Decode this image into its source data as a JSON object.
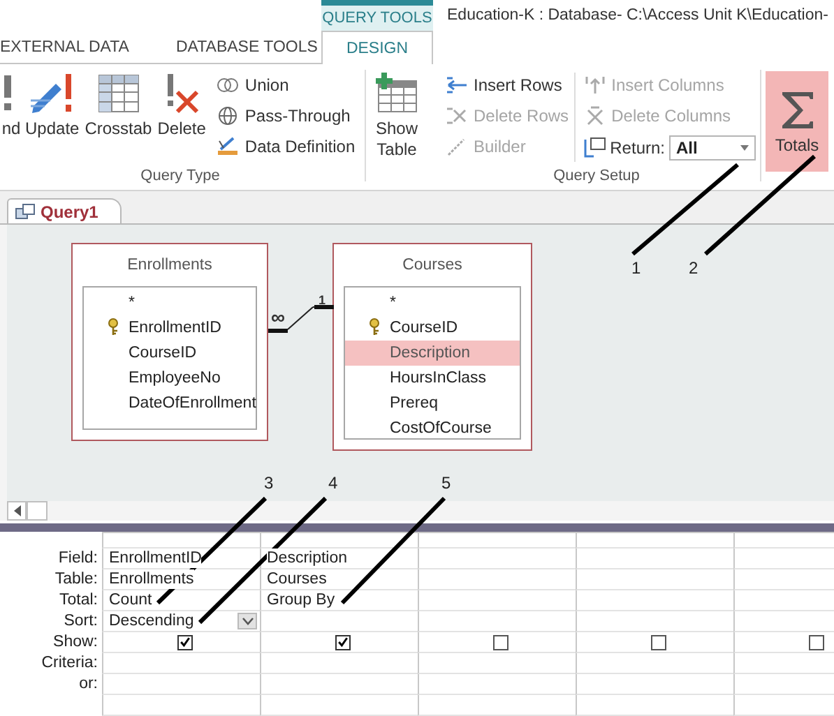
{
  "window": {
    "contextual_tab": "QUERY TOOLS",
    "title": "Education-K : Database- C:\\Access Unit K\\Education-"
  },
  "ribbon_tabs": [
    {
      "label": "EXTERNAL DATA",
      "selected": false
    },
    {
      "label": "DATABASE TOOLS",
      "selected": false
    },
    {
      "label": "DESIGN",
      "selected": true
    }
  ],
  "query_type": {
    "label": "Query Type",
    "large_buttons": [
      {
        "kind": "append",
        "label": "nd"
      },
      {
        "kind": "update",
        "label": "Update"
      },
      {
        "kind": "crosstab",
        "label": "Crosstab"
      },
      {
        "kind": "delete",
        "label": "Delete"
      }
    ],
    "small_buttons": [
      {
        "kind": "union",
        "label": "Union"
      },
      {
        "kind": "passthrough",
        "label": "Pass-Through"
      },
      {
        "kind": "datadef",
        "label": "Data Definition"
      }
    ]
  },
  "show_table": {
    "label": "Show Table"
  },
  "query_setup": {
    "label": "Query Setup",
    "buttons": [
      {
        "kind": "insert_rows",
        "label": "Insert Rows",
        "disabled": false
      },
      {
        "kind": "delete_rows",
        "label": "Delete Rows",
        "disabled": true
      },
      {
        "kind": "builder",
        "label": "Builder",
        "disabled": true
      },
      {
        "kind": "insert_columns",
        "label": "Insert Columns",
        "disabled": true
      },
      {
        "kind": "delete_columns",
        "label": "Delete Columns",
        "disabled": true
      }
    ],
    "return": {
      "label": "Return:",
      "value": "All"
    }
  },
  "totals": {
    "label": "Totals",
    "selected": true
  },
  "document_tabs": [
    {
      "label": "Query1",
      "selected": true
    }
  ],
  "tables": [
    {
      "title": "Enrollments",
      "fields": [
        {
          "name": "*",
          "key": false,
          "selected": false
        },
        {
          "name": "EnrollmentID",
          "key": true,
          "selected": false
        },
        {
          "name": "CourseID",
          "key": false,
          "selected": false
        },
        {
          "name": "EmployeeNo",
          "key": false,
          "selected": false
        },
        {
          "name": "DateOfEnrollment",
          "key": false,
          "selected": false
        }
      ]
    },
    {
      "title": "Courses",
      "fields": [
        {
          "name": "*",
          "key": false,
          "selected": false
        },
        {
          "name": "CourseID",
          "key": true,
          "selected": false
        },
        {
          "name": "Description",
          "key": false,
          "selected": true
        },
        {
          "name": "HoursInClass",
          "key": false,
          "selected": false
        },
        {
          "name": "Prereq",
          "key": false,
          "selected": false
        },
        {
          "name": "CostOfCourse",
          "key": false,
          "selected": false
        }
      ]
    }
  ],
  "relationship": {
    "many": "∞",
    "one": "1"
  },
  "grid": {
    "row_labels": [
      "Field:",
      "Table:",
      "Total:",
      "Sort:",
      "Show:",
      "Criteria:",
      "or:"
    ],
    "columns": [
      {
        "field": "EnrollmentID",
        "table": "Enrollments",
        "total": "Count",
        "sort": "Descending",
        "sort_dropdown": true,
        "show": true
      },
      {
        "field": "Description",
        "table": "Courses",
        "total": "Group By",
        "show": true
      },
      {
        "show": false
      },
      {
        "show": false
      },
      {
        "show": false
      }
    ]
  },
  "callouts": [
    "1",
    "2",
    "3",
    "4",
    "5"
  ]
}
